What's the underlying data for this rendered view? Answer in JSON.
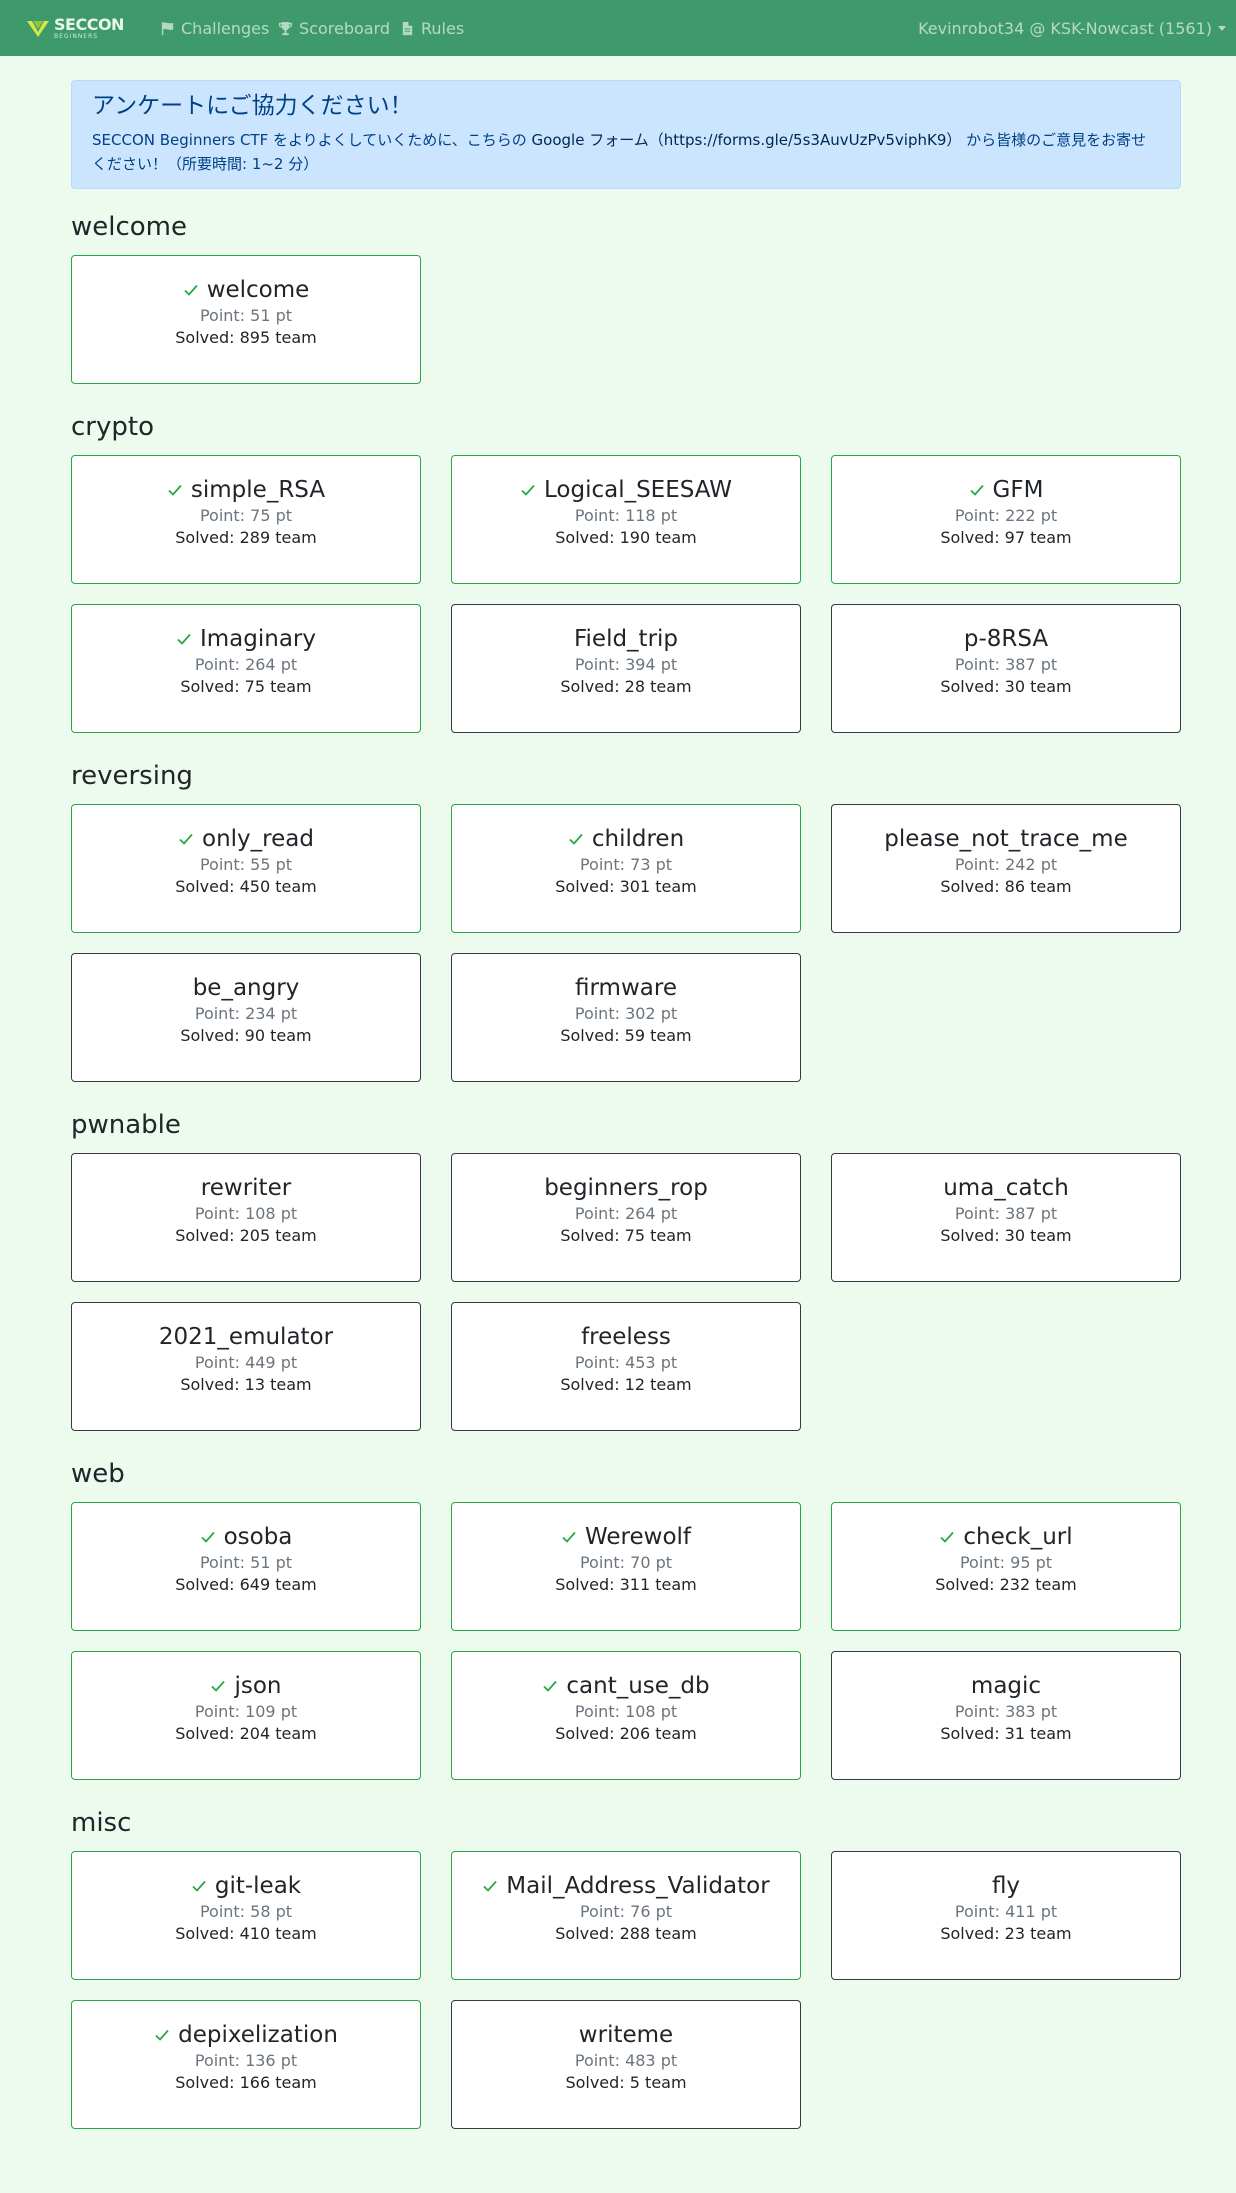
{
  "navbar": {
    "brand_top": "SECCON",
    "brand_bottom": "BEGINNERS",
    "challenges": "Challenges",
    "scoreboard": "Scoreboard",
    "rules": "Rules",
    "user": "Kevinrobot34 @ KSK-Nowcast (1561)"
  },
  "alert": {
    "title": "アンケートにご協力ください！",
    "text_before": "SECCON Beginners CTF をよりよくしていくために、こちらの ",
    "link_text": "Google フォーム（https://forms.gle/5s3AuvUzPv5viphK9）",
    "text_after": " から皆様のご意見をお寄せください！（所要時間: 1~2 分）"
  },
  "sections": [
    {
      "title": "welcome",
      "challenges": [
        {
          "name": "welcome",
          "points": "Point: 51 pt",
          "solves": "Solved: 895 team",
          "solved": true
        }
      ]
    },
    {
      "title": "crypto",
      "challenges": [
        {
          "name": "simple_RSA",
          "points": "Point: 75 pt",
          "solves": "Solved: 289 team",
          "solved": true
        },
        {
          "name": "Logical_SEESAW",
          "points": "Point: 118 pt",
          "solves": "Solved: 190 team",
          "solved": true
        },
        {
          "name": "GFM",
          "points": "Point: 222 pt",
          "solves": "Solved: 97 team",
          "solved": true
        },
        {
          "name": "Imaginary",
          "points": "Point: 264 pt",
          "solves": "Solved: 75 team",
          "solved": true
        },
        {
          "name": "Field_trip",
          "points": "Point: 394 pt",
          "solves": "Solved: 28 team",
          "solved": false
        },
        {
          "name": "p-8RSA",
          "points": "Point: 387 pt",
          "solves": "Solved: 30 team",
          "solved": false
        }
      ]
    },
    {
      "title": "reversing",
      "challenges": [
        {
          "name": "only_read",
          "points": "Point: 55 pt",
          "solves": "Solved: 450 team",
          "solved": true
        },
        {
          "name": "children",
          "points": "Point: 73 pt",
          "solves": "Solved: 301 team",
          "solved": true
        },
        {
          "name": "please_not_trace_me",
          "points": "Point: 242 pt",
          "solves": "Solved: 86 team",
          "solved": false
        },
        {
          "name": "be_angry",
          "points": "Point: 234 pt",
          "solves": "Solved: 90 team",
          "solved": false
        },
        {
          "name": "firmware",
          "points": "Point: 302 pt",
          "solves": "Solved: 59 team",
          "solved": false
        }
      ]
    },
    {
      "title": "pwnable",
      "challenges": [
        {
          "name": "rewriter",
          "points": "Point: 108 pt",
          "solves": "Solved: 205 team",
          "solved": false
        },
        {
          "name": "beginners_rop",
          "points": "Point: 264 pt",
          "solves": "Solved: 75 team",
          "solved": false
        },
        {
          "name": "uma_catch",
          "points": "Point: 387 pt",
          "solves": "Solved: 30 team",
          "solved": false
        },
        {
          "name": "2021_emulator",
          "points": "Point: 449 pt",
          "solves": "Solved: 13 team",
          "solved": false
        },
        {
          "name": "freeless",
          "points": "Point: 453 pt",
          "solves": "Solved: 12 team",
          "solved": false
        }
      ]
    },
    {
      "title": "web",
      "challenges": [
        {
          "name": "osoba",
          "points": "Point: 51 pt",
          "solves": "Solved: 649 team",
          "solved": true
        },
        {
          "name": "Werewolf",
          "points": "Point: 70 pt",
          "solves": "Solved: 311 team",
          "solved": true
        },
        {
          "name": "check_url",
          "points": "Point: 95 pt",
          "solves": "Solved: 232 team",
          "solved": true
        },
        {
          "name": "json",
          "points": "Point: 109 pt",
          "solves": "Solved: 204 team",
          "solved": true
        },
        {
          "name": "cant_use_db",
          "points": "Point: 108 pt",
          "solves": "Solved: 206 team",
          "solved": true
        },
        {
          "name": "magic",
          "points": "Point: 383 pt",
          "solves": "Solved: 31 team",
          "solved": false
        }
      ]
    },
    {
      "title": "misc",
      "challenges": [
        {
          "name": "git-leak",
          "points": "Point: 58 pt",
          "solves": "Solved: 410 team",
          "solved": true
        },
        {
          "name": "Mail_Address_Validator",
          "points": "Point: 76 pt",
          "solves": "Solved: 288 team",
          "solved": true
        },
        {
          "name": "fly",
          "points": "Point: 411 pt",
          "solves": "Solved: 23 team",
          "solved": false
        },
        {
          "name": "depixelization",
          "points": "Point: 136 pt",
          "solves": "Solved: 166 team",
          "solved": true
        },
        {
          "name": "writeme",
          "points": "Point: 483 pt",
          "solves": "Solved: 5 team",
          "solved": false
        }
      ]
    }
  ],
  "colors": {
    "navbar": "#3e9a6a",
    "background": "#edfbef",
    "solved_border": "#28a745",
    "unsolved_border": "#343a40"
  }
}
